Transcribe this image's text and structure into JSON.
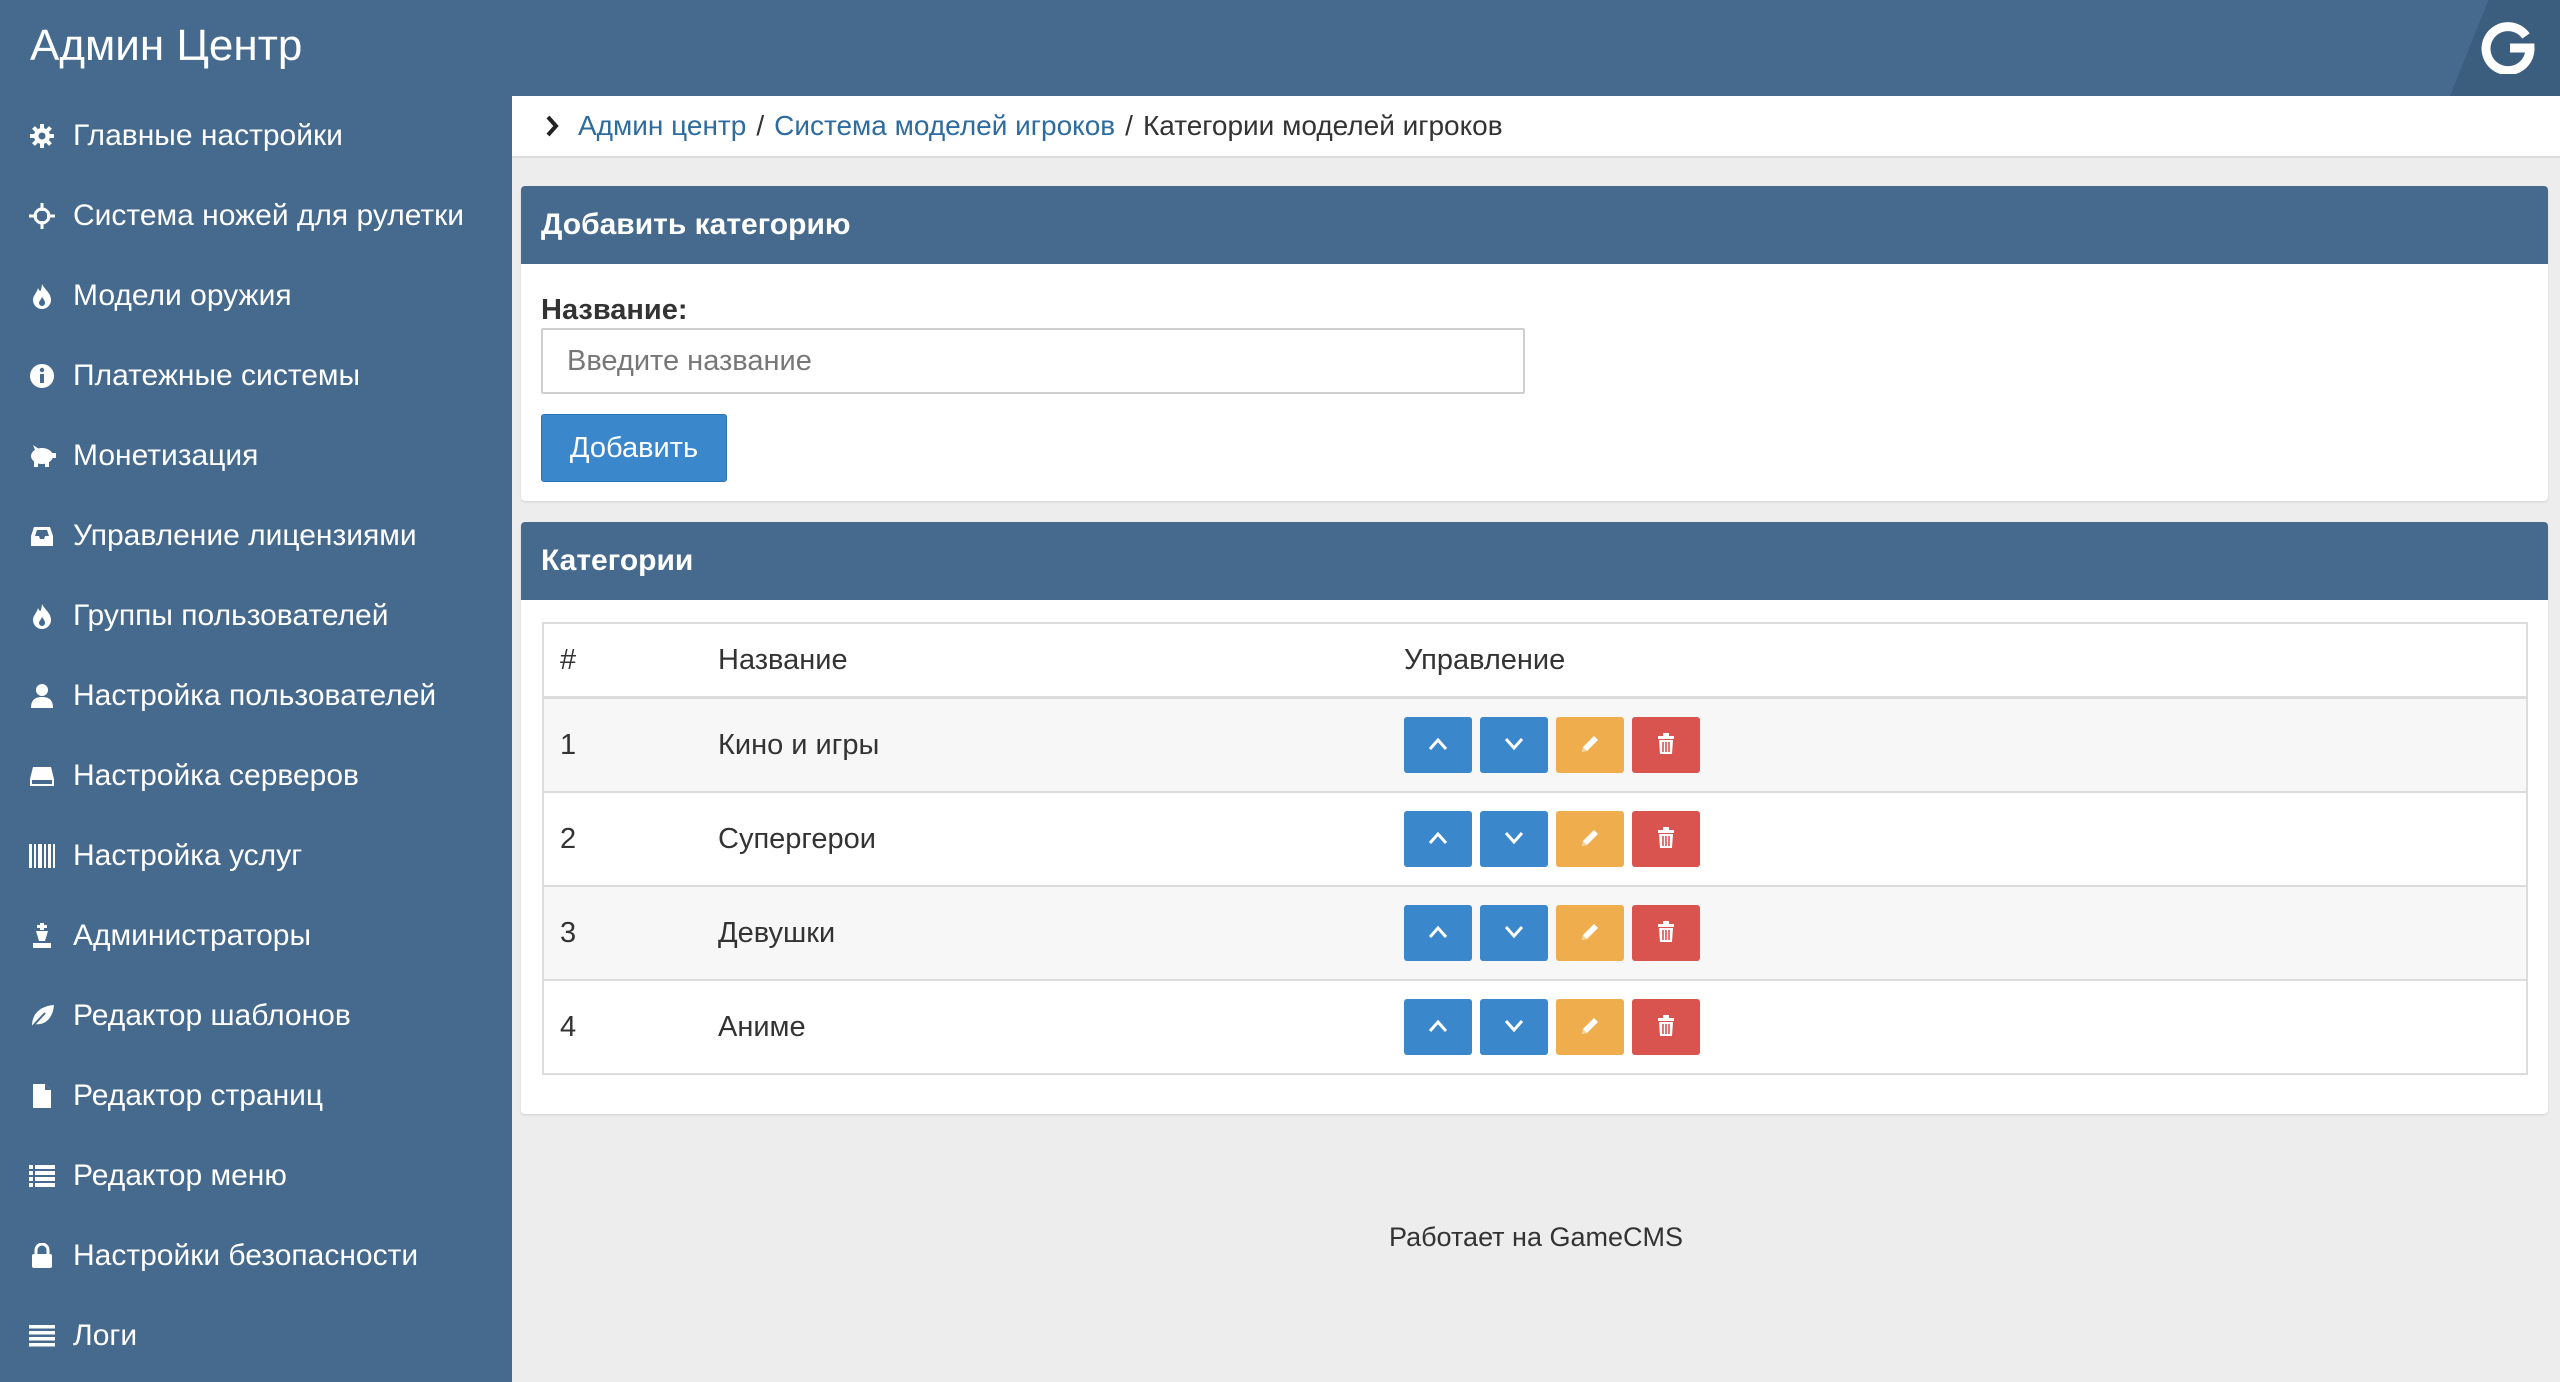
{
  "app": {
    "title": "Админ Центр",
    "logo_icon": "gamecms-g-logo"
  },
  "colors": {
    "header": "#456a8d",
    "primary": "#3a87cc",
    "warning": "#f0ad4e",
    "danger": "#d9534f"
  },
  "sidebar": {
    "items": [
      {
        "label": "Главные настройки",
        "icon": "gear-icon"
      },
      {
        "label": "Система ножей для рулетки",
        "icon": "crosshair-icon"
      },
      {
        "label": "Модели оружия",
        "icon": "fire-icon"
      },
      {
        "label": "Платежные системы",
        "icon": "info-icon"
      },
      {
        "label": "Монетизация",
        "icon": "piggy-bank-icon"
      },
      {
        "label": "Управление лицензиями",
        "icon": "inbox-icon"
      },
      {
        "label": "Группы пользователей",
        "icon": "fire-icon"
      },
      {
        "label": "Настройка пользователей",
        "icon": "user-icon"
      },
      {
        "label": "Настройка серверов",
        "icon": "hdd-icon"
      },
      {
        "label": "Настройка услуг",
        "icon": "barcode-icon"
      },
      {
        "label": "Администраторы",
        "icon": "chess-icon"
      },
      {
        "label": "Редактор шаблонов",
        "icon": "leaf-icon"
      },
      {
        "label": "Редактор страниц",
        "icon": "file-icon"
      },
      {
        "label": "Редактор меню",
        "icon": "list-icon"
      },
      {
        "label": "Настройки безопасности",
        "icon": "lock-icon"
      },
      {
        "label": "Логи",
        "icon": "align-justify-icon"
      }
    ]
  },
  "breadcrumb": {
    "items": [
      {
        "label": "Админ центр"
      },
      {
        "label": "Система моделей игроков"
      }
    ],
    "separator": "/",
    "current": "Категории моделей игроков"
  },
  "add_panel": {
    "title": "Добавить категорию",
    "field_label": "Название:",
    "placeholder": "Введите название",
    "value": "",
    "button": "Добавить"
  },
  "categories_panel": {
    "title": "Категории",
    "columns": [
      "#",
      "Название",
      "Управление"
    ],
    "rows": [
      {
        "num": "1",
        "name": "Кино и игры"
      },
      {
        "num": "2",
        "name": "Супергерои"
      },
      {
        "num": "3",
        "name": "Девушки"
      },
      {
        "num": "4",
        "name": "Аниме"
      }
    ]
  },
  "footer": {
    "text": "Работает на GameCMS"
  }
}
